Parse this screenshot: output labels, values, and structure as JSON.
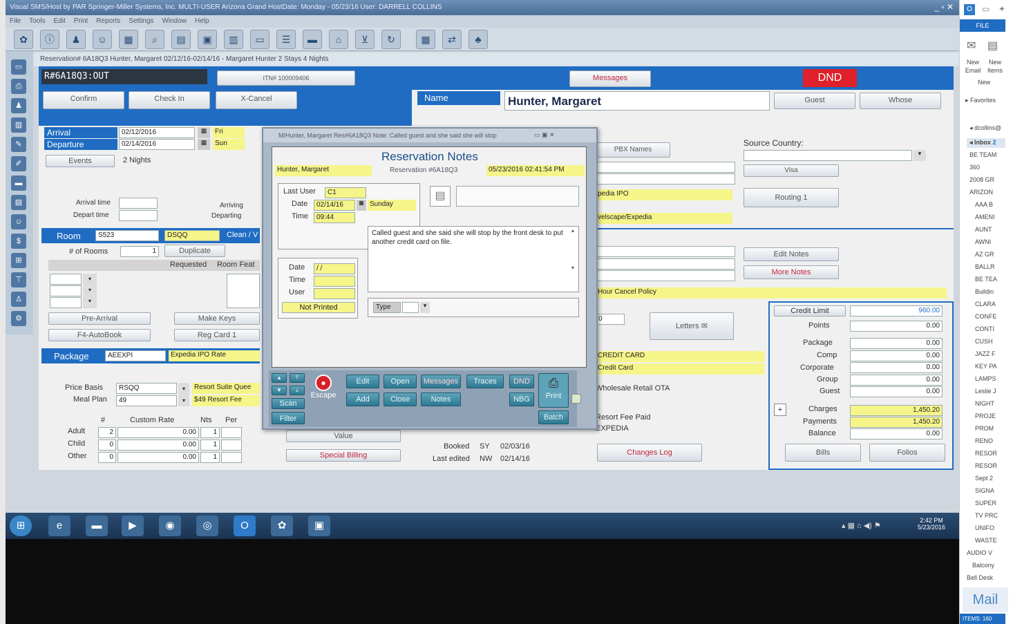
{
  "window": {
    "title": "Visual SMS/Host by PAR Springer-Miller Systems, Inc.   MULTI-USER   Arizona Grand   HostDate: Monday - 05/23/16   User: DARRELL COLLINS"
  },
  "menu": [
    "File",
    "Tools",
    "Edit",
    "Print",
    "Reports",
    "Settings",
    "Window",
    "Help"
  ],
  "resbar": {
    "text": "Reservation# 6A18Q3  Hunter, Margaret  02/12/16-02/14/16   -   Margaret  Hunter 2 Stays 4 Nights"
  },
  "res": {
    "number": "R#6A18Q3:OUT",
    "itn": "ITN# 100009406",
    "messages": "Messages",
    "dnd": "DND",
    "confirm": "Confirm",
    "checkin": "Check In",
    "xcancel": "X-Cancel",
    "name_label": "Name",
    "name": "Hunter, Margaret",
    "guest": "Guest",
    "whose": "Whose",
    "arrival_label": "Arrival",
    "arrival": "02/12/2016",
    "arrival_day": "Fri",
    "departure_label": "Departure",
    "departure": "02/14/2016",
    "departure_day": "Sun",
    "events": "Events",
    "nights": "2 Nights",
    "arrival_time": "Arrival time",
    "depart_time": "Depart time",
    "arriving": "Arriving",
    "departing": "Departing",
    "room_label": "Room",
    "room": "S523",
    "roomtype": "DSQQ",
    "clean": "Clean / V",
    "num_rooms_label": "# of Rooms",
    "num_rooms": "1",
    "duplicate": "Duplicate",
    "requested": "Requested",
    "room_feat": "Room Feat",
    "pre_arrival": "Pre-Arrival",
    "make_keys": "Make Keys",
    "autobook": "F4-AutoBook",
    "reg_card": "Reg Card 1",
    "package_label": "Package",
    "package": "AEEXPI",
    "package_desc": "Expedia IPO Rate",
    "price_basis_label": "Price Basis",
    "price_basis": "RSQQ",
    "price_desc": "Resort Suite Quee",
    "meal_plan_label": "Meal Plan",
    "meal_plan": "49",
    "meal_desc": "$49 Resort Fee",
    "rate_headers": [
      "#",
      "Custom Rate",
      "Nts",
      "Per"
    ],
    "rates": [
      {
        "label": "Adult",
        "n": "2",
        "rate": "0.00",
        "nts": "1"
      },
      {
        "label": "Child",
        "n": "0",
        "rate": "0.00",
        "nts": "1"
      },
      {
        "label": "Other",
        "n": "0",
        "rate": "0.00",
        "nts": "1"
      }
    ],
    "value": "Value",
    "special_billing": "Special Billing",
    "booked_label": "Booked",
    "booked_by": "SY",
    "booked_date": "02/03/16",
    "edited_label": "Last edited",
    "edited_by": "NW",
    "edited_date": "02/14/16",
    "changes_log": "Changes Log",
    "pbx": "PBX Names",
    "source_country": "Source Country:",
    "visa": "Visa",
    "routing": "Routing 1",
    "source1": "pedia IPO",
    "source2": "velscape/Expedia",
    "cancel_policy": "Hour Cancel Policy",
    "edit_notes": "Edit Notes",
    "more_notes": "More Notes",
    "letters": "Letters",
    "payment1": "CREDIT CARD",
    "payment2": "Credit Card",
    "channel": "Wholesale Retail OTA",
    "resort_fee": "Resort Fee Paid",
    "expedia": "EXPEDIA",
    "zero": "0",
    "credit_limit_label": "Credit Limit",
    "credit_limit": "960.00",
    "fin": [
      {
        "label": "Points",
        "val": "0.00"
      },
      {
        "label": "Package",
        "val": "0.00"
      },
      {
        "label": "Comp",
        "val": "0.00"
      },
      {
        "label": "Corporate",
        "val": "0.00"
      },
      {
        "label": "Group",
        "val": "0.00"
      },
      {
        "label": "Guest",
        "val": "0.00"
      }
    ],
    "charges_label": "Charges",
    "charges": "1,450.20",
    "payments_label": "Payments",
    "payments": "1,450.20",
    "balance_label": "Balance",
    "balance": "0.00",
    "bills": "Bills",
    "folios": "Folios"
  },
  "dialog": {
    "title": "M/Hunter, Margaret  Res#6A18Q3  Note: Called guest and she said she will stop",
    "heading": "Reservation Notes",
    "name": "Hunter, Margaret",
    "resnum": "Reservation #6A18Q3",
    "timestamp": "05/23/2016 02:41:54 PM",
    "last_user_label": "Last User",
    "last_user": "C1",
    "date_label": "Date",
    "date": "02/14/16",
    "day": "Sunday",
    "time_label": "Time",
    "time": "09:44",
    "note": "Called guest and she said she will stop by the front desk to put another credit card on file.",
    "date2": "/ /",
    "time2_label": "Time",
    "user2_label": "User",
    "not_printed": "Not Printed",
    "type_label": "Type",
    "buttons": {
      "scan": "Scan",
      "filter": "Filter",
      "escape": "Escape",
      "edit": "Edit",
      "open": "Open",
      "messages": "Messages",
      "traces": "Traces",
      "dnd": "DND",
      "add": "Add",
      "close": "Close",
      "notes": "Notes",
      "nbg": "NBG",
      "print": "Print",
      "batch": "Batch"
    }
  },
  "taskbar": {
    "time": "2:42 PM",
    "date": "5/23/2016"
  },
  "outlook": {
    "file": "FILE",
    "new_email": "New Email",
    "new_items": "New Items",
    "new": "New",
    "favorites": "Favorites",
    "account": "dcollins@",
    "inbox": "Inbox",
    "inbox_count": "2",
    "folders": [
      "BE TEAM",
      "360",
      "2008 GR",
      "ARIZON",
      "AAA B",
      "AMENI",
      "AUNT",
      "AWNI",
      "AZ GR",
      "BALLR",
      "BE TEA",
      "Buildin",
      "CLARA",
      "CONFE",
      "CONTI",
      "CUSH",
      "JAZZ F",
      "KEY PA",
      "LAMPS",
      "Leslie J",
      "NIGHT",
      "PROJE",
      "PROM",
      "RENO",
      "RESOR",
      "RESOR",
      "Sept 2",
      "SIGNA",
      "SUPER",
      "TV PRC",
      "UNIFO",
      "WASTE",
      "AUDIO V",
      "Balcony",
      "Bell Desk"
    ],
    "mail": "Mail",
    "items": "ITEMS: 160"
  },
  "colors": {
    "accent_blue": "#1f6cc2",
    "highlight_yellow": "#f5f58a",
    "dnd_red": "#e0202a",
    "alert_text": "#c0283c"
  }
}
